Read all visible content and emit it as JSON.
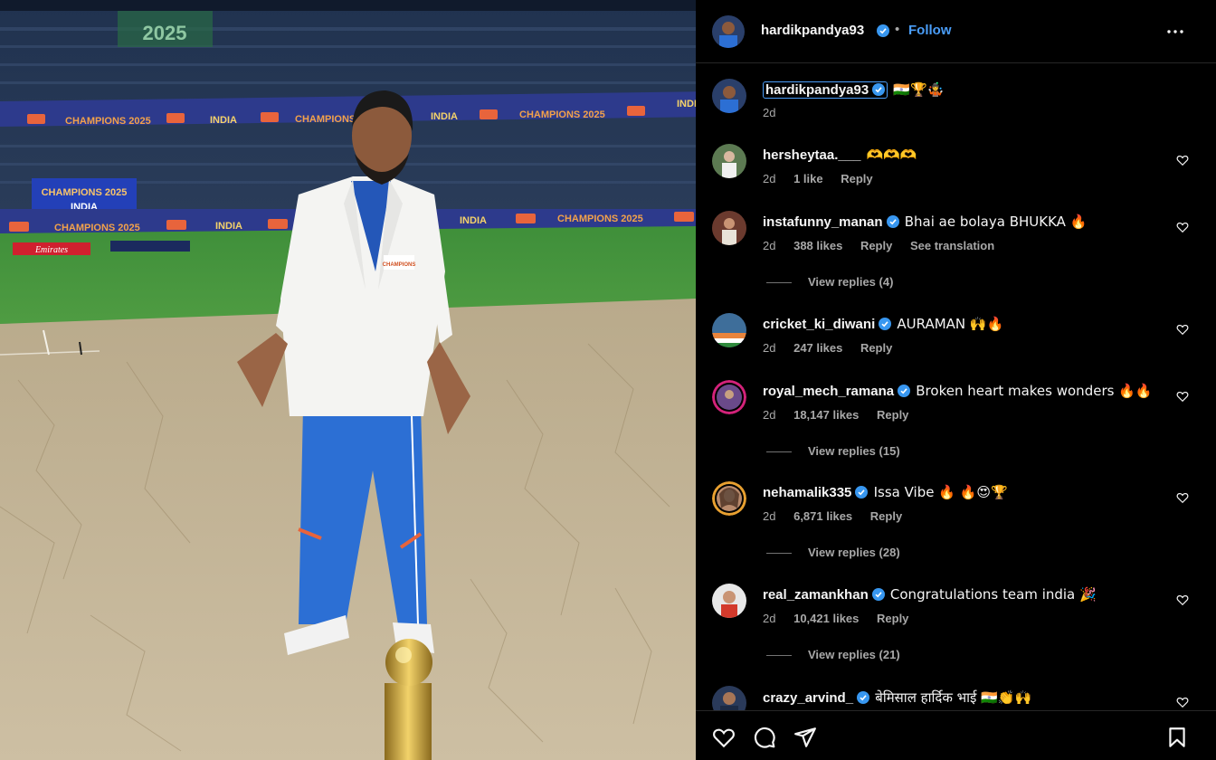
{
  "post": {
    "author": "hardikpandya93",
    "follow_label": "Follow",
    "separator": "•",
    "photo_text": {
      "banner_champions": "CHAMPIONS 2025",
      "banner_india": "INDIA",
      "badge": "2025",
      "screen_line1": "CHAMPIONS 2025",
      "screen_line2": "INDIA",
      "sponsor": "Emirates",
      "top_sign": "2025"
    }
  },
  "caption": {
    "user": "hardikpandya93",
    "text": "🇮🇳🏆🤹",
    "time": "2d"
  },
  "comments": [
    {
      "user": "hersheytaa.___",
      "verified": false,
      "text": "🫶🫶🫶",
      "time": "2d",
      "likes": "1 like",
      "reply": "Reply",
      "translation": "",
      "view_replies": ""
    },
    {
      "user": "instafunny_manan",
      "verified": true,
      "text": "Bhai ae bolaya BHUKKA 🔥",
      "time": "2d",
      "likes": "388 likes",
      "reply": "Reply",
      "translation": "See translation",
      "view_replies": "View replies (4)"
    },
    {
      "user": "cricket_ki_diwani",
      "verified": true,
      "text": "AURAMAN 🙌🔥",
      "time": "2d",
      "likes": "247 likes",
      "reply": "Reply",
      "translation": "",
      "view_replies": ""
    },
    {
      "user": "royal_mech_ramana",
      "verified": true,
      "text": "Broken heart makes wonders 🔥🔥",
      "time": "2d",
      "likes": "18,147 likes",
      "reply": "Reply",
      "translation": "",
      "view_replies": "View replies (15)"
    },
    {
      "user": "nehamalik335",
      "verified": true,
      "text": "Issa Vibe 🔥 🔥😍🏆",
      "time": "2d",
      "likes": "6,871 likes",
      "reply": "Reply",
      "translation": "",
      "view_replies": "View replies (28)"
    },
    {
      "user": "real_zamankhan",
      "verified": true,
      "text": "Congratulations team india 🎉",
      "time": "2d",
      "likes": "10,421 likes",
      "reply": "Reply",
      "translation": "",
      "view_replies": "View replies (21)"
    },
    {
      "user": "crazy_arvind_",
      "verified": true,
      "text": "बेमिसाल हार्दिक भाई 🇮🇳👏🙌",
      "time": "",
      "likes": "",
      "reply": "",
      "translation": "",
      "view_replies": ""
    }
  ],
  "colors": {
    "link": "#4a9df8",
    "verified": "#3897f0",
    "muted": "#a8a8a8",
    "text": "#f5f5f5",
    "background": "#000000"
  },
  "icons": {
    "more": "more-horizontal-icon",
    "verified": "verified-badge-icon",
    "like": "heart-icon",
    "comment": "comment-icon",
    "share": "send-icon",
    "save": "bookmark-icon"
  }
}
